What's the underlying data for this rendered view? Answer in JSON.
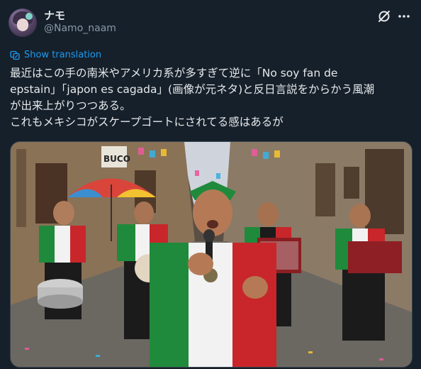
{
  "author": {
    "display_name": "ナモ",
    "handle": "@Namo_naam"
  },
  "actions": {
    "grok_icon": "grok-icon",
    "more_icon": "more-dots-icon"
  },
  "translation": {
    "label": "Show translation"
  },
  "post": {
    "lines": [
      "最近はこの手の南米やアメリカ系が多すぎて逆に「No soy fan de",
      "epstain」「japon es cagada」(画像が元ネタ)と反日言説をからかう風潮",
      "が出来上がりつつある。",
      "これもメキシコがスケープゴートにされてる感はあるが"
    ]
  },
  "media": {
    "sign_text": "BUCO",
    "colors": {
      "green": "#1f8a3b",
      "white": "#f2f2f2",
      "red": "#c8262b"
    }
  }
}
